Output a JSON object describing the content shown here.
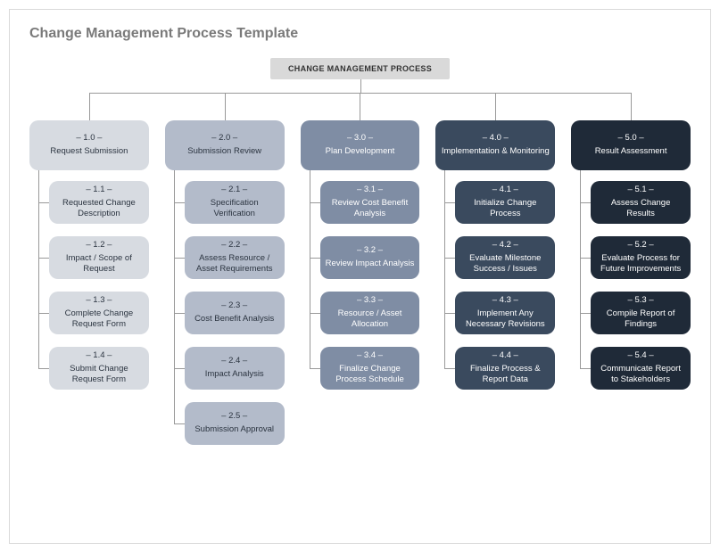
{
  "title": "Change Management Process Template",
  "root": "CHANGE MANAGEMENT PROCESS",
  "columns": [
    {
      "theme": "c1",
      "head_num": "– 1.0 –",
      "head_label": "Request Submission",
      "children": [
        {
          "num": "– 1.1 –",
          "label": "Requested Change Description"
        },
        {
          "num": "– 1.2 –",
          "label": "Impact / Scope of Request"
        },
        {
          "num": "– 1.3 –",
          "label": "Complete Change Request Form"
        },
        {
          "num": "– 1.4 –",
          "label": "Submit Change Request Form"
        }
      ]
    },
    {
      "theme": "c2",
      "head_num": "– 2.0 –",
      "head_label": "Submission Review",
      "children": [
        {
          "num": "– 2.1 –",
          "label": "Specification Verification"
        },
        {
          "num": "– 2.2 –",
          "label": "Assess Resource / Asset Requirements"
        },
        {
          "num": "– 2.3 –",
          "label": "Cost Benefit Analysis"
        },
        {
          "num": "– 2.4 –",
          "label": "Impact Analysis"
        },
        {
          "num": "– 2.5 –",
          "label": "Submission Approval"
        }
      ]
    },
    {
      "theme": "c3",
      "head_num": "– 3.0 –",
      "head_label": "Plan Development",
      "children": [
        {
          "num": "– 3.1 –",
          "label": "Review Cost Benefit Analysis"
        },
        {
          "num": "– 3.2 –",
          "label": "Review Impact Analysis"
        },
        {
          "num": "– 3.3 –",
          "label": "Resource / Asset Allocation"
        },
        {
          "num": "– 3.4 –",
          "label": "Finalize Change Process Schedule"
        }
      ]
    },
    {
      "theme": "c4",
      "head_num": "– 4.0 –",
      "head_label": "Implementation & Monitoring",
      "children": [
        {
          "num": "– 4.1 –",
          "label": "Initialize Change Process"
        },
        {
          "num": "– 4.2 –",
          "label": "Evaluate Milestone Success / Issues"
        },
        {
          "num": "– 4.3 –",
          "label": "Implement Any Necessary Revisions"
        },
        {
          "num": "– 4.4 –",
          "label": "Finalize Process & Report Data"
        }
      ]
    },
    {
      "theme": "c5",
      "head_num": "– 5.0 –",
      "head_label": "Result Assessment",
      "children": [
        {
          "num": "– 5.1 –",
          "label": "Assess Change Results"
        },
        {
          "num": "– 5.2 –",
          "label": "Evaluate Process for Future Improvements"
        },
        {
          "num": "– 5.3 –",
          "label": "Compile Report of Findings"
        },
        {
          "num": "– 5.4 –",
          "label": "Communicate Report to Stakeholders"
        }
      ]
    }
  ]
}
